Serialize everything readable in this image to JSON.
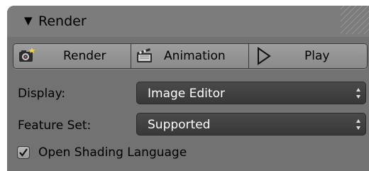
{
  "panel": {
    "title": "Render",
    "expanded_icon": "triangle-down-icon"
  },
  "buttons": [
    {
      "label": "Render",
      "icon": "camera-render-icon"
    },
    {
      "label": "Animation",
      "icon": "clapperboard-icon"
    },
    {
      "label": "Play",
      "icon": "play-triangle-icon"
    }
  ],
  "display": {
    "label": "Display:",
    "value": "Image Editor"
  },
  "feature_set": {
    "label": "Feature Set:",
    "value": "Supported"
  },
  "osl": {
    "label": "Open Shading Language",
    "checked": true
  },
  "colors": {
    "panel_bg": "#727272",
    "header_bg": "#7c7c7c",
    "button_bg": "#9a9a9a",
    "select_bg": "#404040"
  }
}
